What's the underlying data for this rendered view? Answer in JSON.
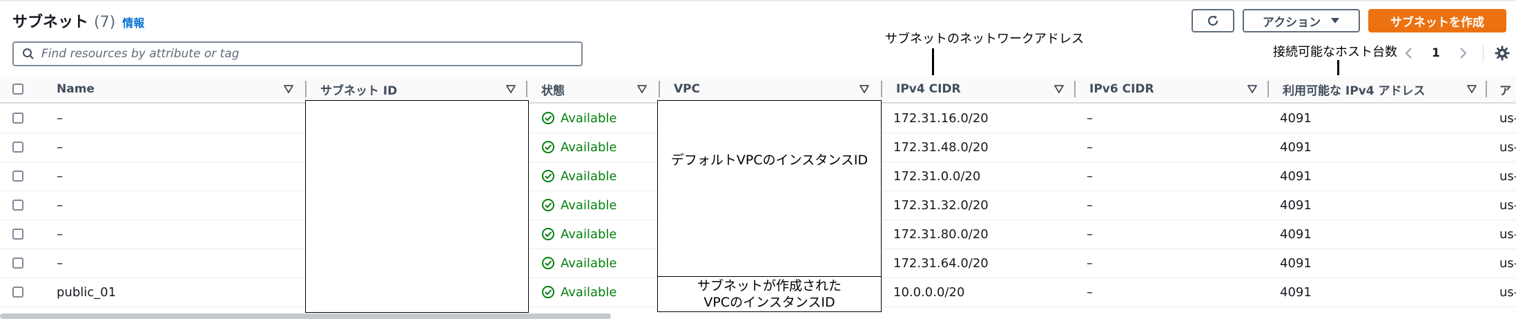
{
  "header": {
    "title": "サブネット",
    "count": "(7)",
    "info_link": "情報",
    "action_label": "アクション",
    "create_label": "サブネットを作成"
  },
  "search": {
    "placeholder": "Find resources by attribute or tag",
    "value": ""
  },
  "pagination": {
    "current_page": "1"
  },
  "annotations": {
    "network_address": "サブネットのネットワークアドレス",
    "available_hosts": "接続可能なホスト台数",
    "default_vpc": "デフォルトVPCのインスタンスID",
    "created_vpc_line1": "サブネットが作成された",
    "created_vpc_line2": "VPCのインスタンスID"
  },
  "columns": [
    {
      "label": "Name"
    },
    {
      "label": "サブネット ID"
    },
    {
      "label": "状態"
    },
    {
      "label": "VPC"
    },
    {
      "label": "IPv4 CIDR"
    },
    {
      "label": "IPv6 CIDR"
    },
    {
      "label": "利用可能な IPv4 アドレス"
    },
    {
      "label": "ア"
    }
  ],
  "rows": [
    {
      "name": "–",
      "status": "Available",
      "ipv4_cidr": "172.31.16.0/20",
      "ipv6_cidr": "–",
      "available_ipv4": "4091",
      "az": "us-"
    },
    {
      "name": "–",
      "status": "Available",
      "ipv4_cidr": "172.31.48.0/20",
      "ipv6_cidr": "–",
      "available_ipv4": "4091",
      "az": "us-"
    },
    {
      "name": "–",
      "status": "Available",
      "ipv4_cidr": "172.31.0.0/20",
      "ipv6_cidr": "–",
      "available_ipv4": "4091",
      "az": "us-"
    },
    {
      "name": "–",
      "status": "Available",
      "ipv4_cidr": "172.31.32.0/20",
      "ipv6_cidr": "–",
      "available_ipv4": "4091",
      "az": "us-"
    },
    {
      "name": "–",
      "status": "Available",
      "ipv4_cidr": "172.31.80.0/20",
      "ipv6_cidr": "–",
      "available_ipv4": "4091",
      "az": "us-"
    },
    {
      "name": "–",
      "status": "Available",
      "ipv4_cidr": "172.31.64.0/20",
      "ipv6_cidr": "–",
      "available_ipv4": "4091",
      "az": "us-"
    },
    {
      "name": "public_01",
      "status": "Available",
      "ipv4_cidr": "10.0.0.0/20",
      "ipv6_cidr": "–",
      "available_ipv4": "4091",
      "az": "us-"
    }
  ],
  "colors": {
    "primary_orange": "#ec7211",
    "link_blue": "#0972d3",
    "status_green": "#037f0c",
    "text_dark": "#16191f",
    "header_text": "#414d5c"
  },
  "icons": {
    "refresh": "refresh-icon",
    "action_dropdown": "caret-down-icon",
    "search": "search-icon",
    "page_prev": "chevron-left-icon",
    "page_next": "chevron-right-icon",
    "settings": "gear-icon",
    "sort": "sort-down-icon",
    "status_available": "check-circle-icon"
  }
}
